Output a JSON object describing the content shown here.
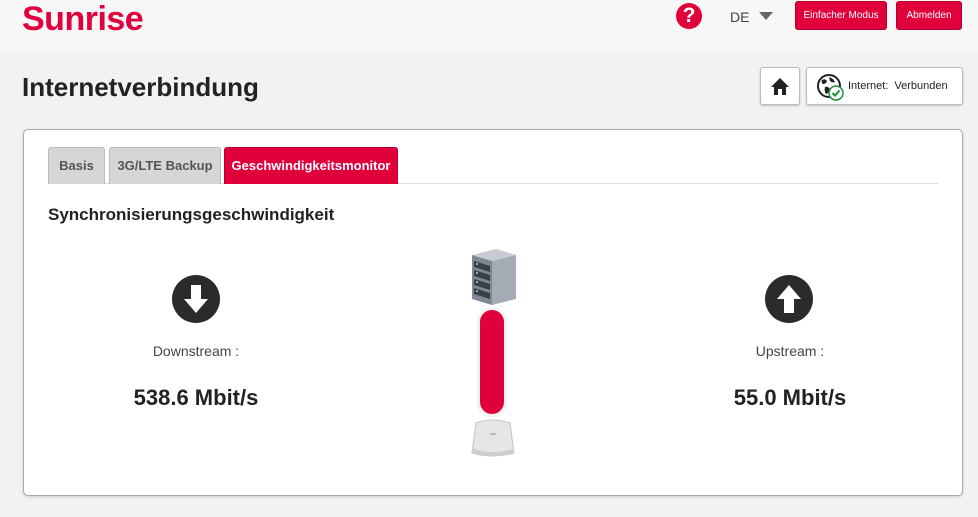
{
  "header": {
    "logo": "Sunrise",
    "help_symbol": "?",
    "language": "DE",
    "simple_mode_label": "Einfacher Modus",
    "logout_label": "Abmelden"
  },
  "page": {
    "title": "Internetverbindung",
    "connection_status_label": "Internet:",
    "connection_status_value": "Verbunden"
  },
  "tabs": [
    {
      "label": "Basis",
      "active": false
    },
    {
      "label": "3G/LTE Backup",
      "active": false
    },
    {
      "label": "Geschwindigkeitsmonitor",
      "active": true
    }
  ],
  "speed_monitor": {
    "section_title": "Synchronisierungsgeschwindigkeit",
    "downstream": {
      "label": "Downstream :",
      "value": "538.6 Mbit/s"
    },
    "upstream": {
      "label": "Upstream :",
      "value": "55.0 Mbit/s"
    }
  },
  "icons": {
    "help": "question-circle-icon",
    "home": "home-icon",
    "globe": "globe-check-icon",
    "down": "arrow-down-circle-icon",
    "up": "arrow-up-circle-icon",
    "server": "server-rack-icon",
    "router": "router-device-icon"
  },
  "colors": {
    "brand": "#e0003c",
    "connected": "#1a8f3c"
  }
}
